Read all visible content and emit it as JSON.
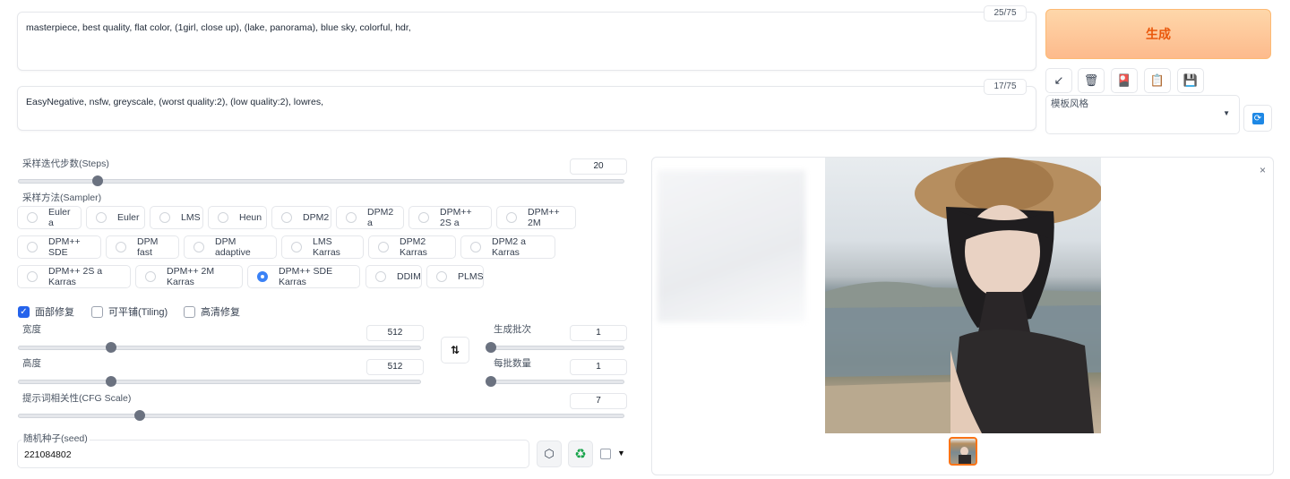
{
  "prompt": {
    "text": "masterpiece, best quality, flat color, (1girl, close up), (lake, panorama), blue sky, colorful, hdr,",
    "counter": "25/75"
  },
  "negative_prompt": {
    "text": "EasyNegative, nsfw, greyscale, (worst quality:2), (low quality:2), lowres,",
    "counter": "17/75"
  },
  "generate_label": "生成",
  "tools": [
    {
      "icon": "arrow-icon",
      "glyph": "↙"
    },
    {
      "icon": "trash-icon",
      "glyph": "🗑"
    },
    {
      "icon": "card-icon",
      "glyph": "🎴"
    },
    {
      "icon": "clipboard-icon",
      "glyph": "📋"
    },
    {
      "icon": "save-icon",
      "glyph": "💾"
    }
  ],
  "styles": {
    "label": "模板风格",
    "value": ""
  },
  "steps": {
    "label": "采样迭代步数(Steps)",
    "value": "20",
    "fraction": 0.13
  },
  "sampler": {
    "label": "采样方法(Sampler)",
    "selected": "DPM++ SDE Karras",
    "options": [
      "Euler a",
      "Euler",
      "LMS",
      "Heun",
      "DPM2",
      "DPM2 a",
      "DPM++ 2S a",
      "DPM++ 2M",
      "DPM++ SDE",
      "DPM fast",
      "DPM adaptive",
      "LMS Karras",
      "DPM2 Karras",
      "DPM2 a Karras",
      "DPM++ 2S a Karras",
      "DPM++ 2M Karras",
      "DPM++ SDE Karras",
      "DDIM",
      "PLMS"
    ]
  },
  "checks": [
    {
      "label": "面部修复",
      "checked": true
    },
    {
      "label": "可平铺(Tiling)",
      "checked": false
    },
    {
      "label": "高清修复",
      "checked": false
    }
  ],
  "width": {
    "label": "宽度",
    "value": "512",
    "fraction": 0.23
  },
  "height": {
    "label": "高度",
    "value": "512",
    "fraction": 0.23
  },
  "batch_count": {
    "label": "生成批次",
    "value": "1",
    "fraction": 0.0
  },
  "batch_size": {
    "label": "每批数量",
    "value": "1",
    "fraction": 0.0
  },
  "cfg": {
    "label": "提示词相关性(CFG Scale)",
    "value": "7",
    "fraction": 0.2
  },
  "seed": {
    "label": "随机种子(seed)",
    "value": "221084802"
  },
  "colors": {
    "accent": "#ea580c",
    "primary": "#2563eb"
  }
}
